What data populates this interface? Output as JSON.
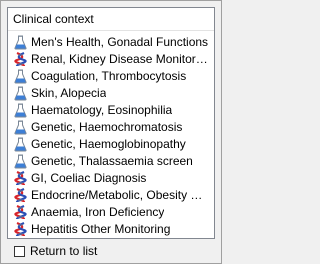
{
  "list": {
    "header": "Clinical context",
    "items": [
      {
        "label": "Men's Health, Gonadal Functions",
        "icon": "flask-icon"
      },
      {
        "label": "Renal, Kidney Disease Monitoring",
        "icon": "dna-icon"
      },
      {
        "label": "Coagulation, Thrombocytosis",
        "icon": "flask-icon"
      },
      {
        "label": "Skin, Alopecia",
        "icon": "flask-icon"
      },
      {
        "label": "Haematology, Eosinophilia",
        "icon": "flask-icon"
      },
      {
        "label": "Genetic, Haemochromatosis",
        "icon": "flask-icon"
      },
      {
        "label": "Genetic, Haemoglobinopathy",
        "icon": "flask-icon"
      },
      {
        "label": "Genetic, Thalassaemia screen",
        "icon": "flask-icon"
      },
      {
        "label": "GI, Coeliac Diagnosis",
        "icon": "dna-icon"
      },
      {
        "label": "Endocrine/Metabolic, Obesity Mo...",
        "icon": "dna-icon"
      },
      {
        "label": "Anaemia, Iron Deficiency",
        "icon": "dna-icon"
      },
      {
        "label": "Hepatitis Other Monitoring",
        "icon": "dna-icon"
      }
    ]
  },
  "footer": {
    "return_label": "Return to list",
    "return_checked": false
  },
  "colors": {
    "flask_liquid": "#3d7fd6",
    "dna_red": "#d8232a",
    "dna_blue": "#2a4fb5"
  }
}
